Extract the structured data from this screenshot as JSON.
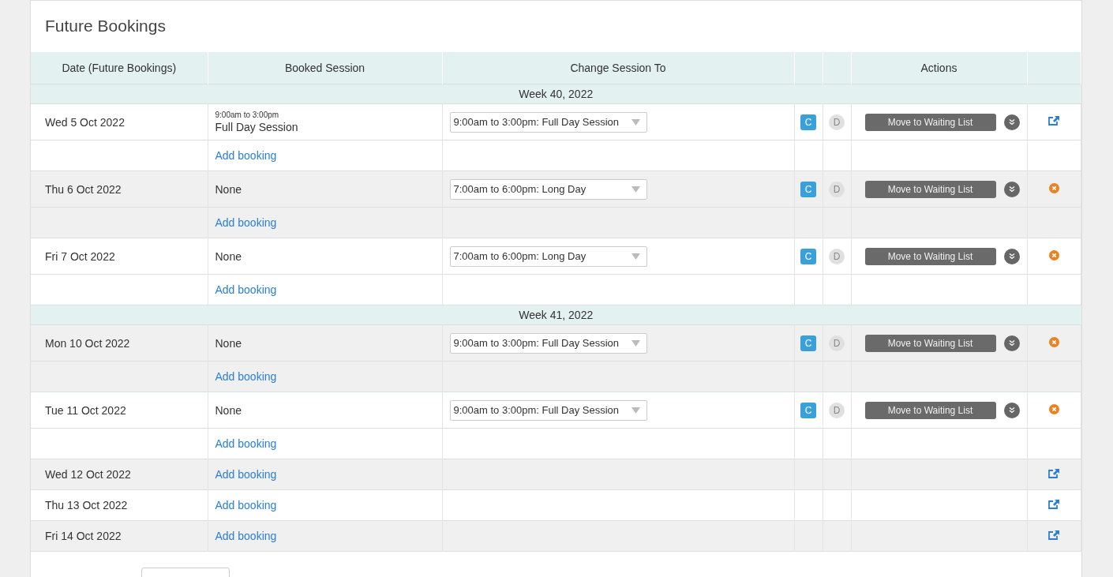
{
  "title": "Future Bookings",
  "columns": [
    "Date (Future Bookings)",
    "Booked Session",
    "Change Session To",
    "",
    "",
    "Actions",
    ""
  ],
  "rows": [
    {
      "kind": "week",
      "label": "Week 40, 2022"
    },
    {
      "kind": "day",
      "date": "Wed 5 Oct 2022",
      "booked_time": "9:00am to 3:00pm",
      "booked_session": "Full Day Session",
      "change_to": "9:00am to 3:00pm: Full Day Session",
      "c": {
        "label": "C",
        "disabled": false
      },
      "d": {
        "label": "D",
        "disabled": true
      },
      "action": "Move to Waiting List",
      "end_icon": {
        "kind": "external"
      },
      "add_label": "Add booking"
    },
    {
      "kind": "day",
      "date": "Thu 6 Oct 2022",
      "booked_session": "None",
      "change_to": "7:00am to 6:00pm: Long Day",
      "c": {
        "label": "C",
        "disabled": false
      },
      "d": {
        "label": "D",
        "disabled": true
      },
      "action": "Move to Waiting List",
      "end_icon": {
        "kind": "remove"
      },
      "add_label": "Add booking"
    },
    {
      "kind": "day",
      "date": "Fri 7 Oct 2022",
      "booked_session": "None",
      "change_to": "7:00am to 6:00pm: Long Day",
      "c": {
        "label": "C",
        "disabled": false
      },
      "d": {
        "label": "D",
        "disabled": true
      },
      "action": "Move to Waiting List",
      "end_icon": {
        "kind": "remove"
      },
      "add_label": "Add booking"
    },
    {
      "kind": "week",
      "label": "Week 41, 2022"
    },
    {
      "kind": "day",
      "date": "Mon 10 Oct 2022",
      "booked_session": "None",
      "change_to": "9:00am to 3:00pm: Full Day Session",
      "c": {
        "label": "C",
        "disabled": false
      },
      "d": {
        "label": "D",
        "disabled": true
      },
      "action": "Move to Waiting List",
      "end_icon": {
        "kind": "remove"
      },
      "add_label": "Add booking"
    },
    {
      "kind": "day",
      "date": "Tue 11 Oct 2022",
      "booked_session": "None",
      "change_to": "9:00am to 3:00pm: Full Day Session",
      "c": {
        "label": "C",
        "disabled": false
      },
      "d": {
        "label": "D",
        "disabled": true
      },
      "action": "Move to Waiting List",
      "end_icon": {
        "kind": "remove"
      },
      "add_label": "Add booking"
    },
    {
      "kind": "open",
      "date": "Wed 12 Oct 2022",
      "add_label": "Add booking",
      "end_icon": {
        "kind": "external"
      }
    },
    {
      "kind": "open",
      "date": "Thu 13 Oct 2022",
      "add_label": "Add booking",
      "end_icon": {
        "kind": "external"
      }
    },
    {
      "kind": "open",
      "date": "Fri 14 Oct 2022",
      "add_label": "Add booking",
      "end_icon": {
        "kind": "external"
      }
    }
  ]
}
